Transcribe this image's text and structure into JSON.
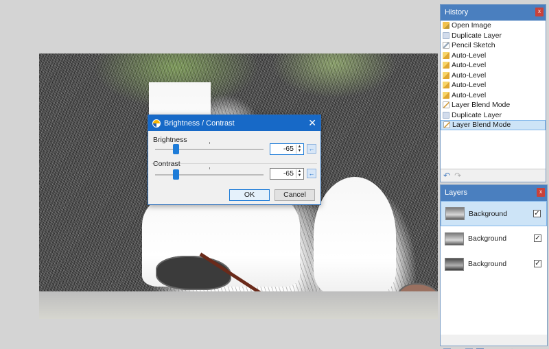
{
  "canvas": {
    "description_icon": "waterfall-pencil-sketch-image"
  },
  "history": {
    "title": "History",
    "close": "x",
    "items": [
      {
        "label": "Open Image",
        "icon": "open-image-icon"
      },
      {
        "label": "Duplicate Layer",
        "icon": "duplicate-layer-icon"
      },
      {
        "label": "Pencil Sketch",
        "icon": "pencil-sketch-icon"
      },
      {
        "label": "Auto-Level",
        "icon": "auto-level-icon"
      },
      {
        "label": "Auto-Level",
        "icon": "auto-level-icon"
      },
      {
        "label": "Auto-Level",
        "icon": "auto-level-icon"
      },
      {
        "label": "Auto-Level",
        "icon": "auto-level-icon"
      },
      {
        "label": "Auto-Level",
        "icon": "auto-level-icon"
      },
      {
        "label": "Layer Blend Mode",
        "icon": "layer-blend-mode-icon"
      },
      {
        "label": "Duplicate Layer",
        "icon": "duplicate-layer-icon"
      },
      {
        "label": "Layer Blend Mode",
        "icon": "layer-blend-mode-icon"
      }
    ],
    "selected_index": 10
  },
  "layers": {
    "title": "Layers",
    "close": "x",
    "items": [
      {
        "name": "Background",
        "visible": true,
        "check": "✓"
      },
      {
        "name": "Background",
        "visible": true,
        "check": "✓"
      },
      {
        "name": "Background",
        "visible": true,
        "check": "✓"
      }
    ],
    "selected_index": 0
  },
  "dialog": {
    "title": "Brightness / Contrast",
    "close": "✕",
    "brightness": {
      "label": "Brightness",
      "value": "-65",
      "slider_value": -65,
      "min": -100,
      "max": 100
    },
    "contrast": {
      "label": "Contrast",
      "value": "-65",
      "slider_value": -65,
      "min": -100,
      "max": 100
    },
    "reset_icon": "←",
    "ok_label": "OK",
    "cancel_label": "Cancel"
  },
  "colors": {
    "accent": "#1769c7",
    "panel_head": "#4a7fbf",
    "selection": "#cde4f7"
  }
}
